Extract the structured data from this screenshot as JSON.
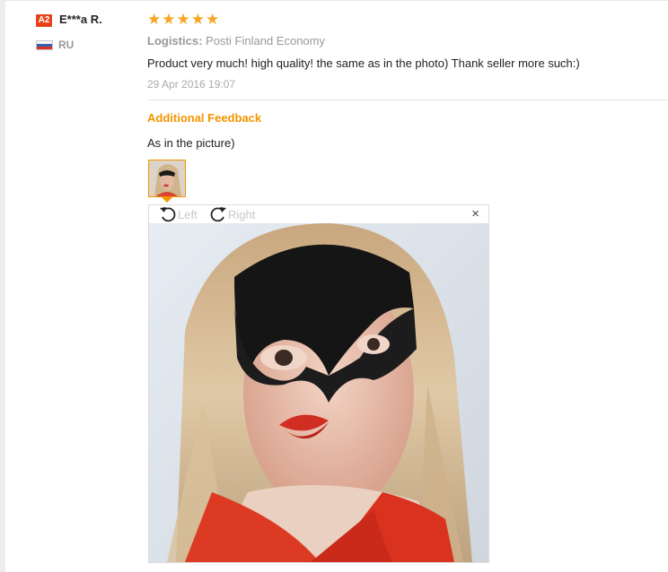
{
  "review": {
    "level_badge": "A2",
    "user_name": "E***a R.",
    "country": "RU",
    "stars": "★★★★★",
    "rating": 5,
    "logistics_label": "Logistics:",
    "logistics_value": "Posti Finland Economy",
    "text": "Product very much! high quality! the same as in the photo) Thank seller more such:)",
    "date": "29 Apr 2016 19:07"
  },
  "additional_feedback": {
    "title": "Additional Feedback",
    "text": "As in the picture)"
  },
  "viewer": {
    "rotate_left_label": "Left",
    "rotate_right_label": "Right",
    "close_label": "×"
  },
  "colors": {
    "accent": "#f59500",
    "stars": "#f5a623",
    "badge": "#e8421c",
    "muted": "#999999"
  },
  "icons": [
    "rotate-left-icon",
    "rotate-right-icon",
    "close-icon",
    "russia-flag-icon",
    "level-badge"
  ]
}
